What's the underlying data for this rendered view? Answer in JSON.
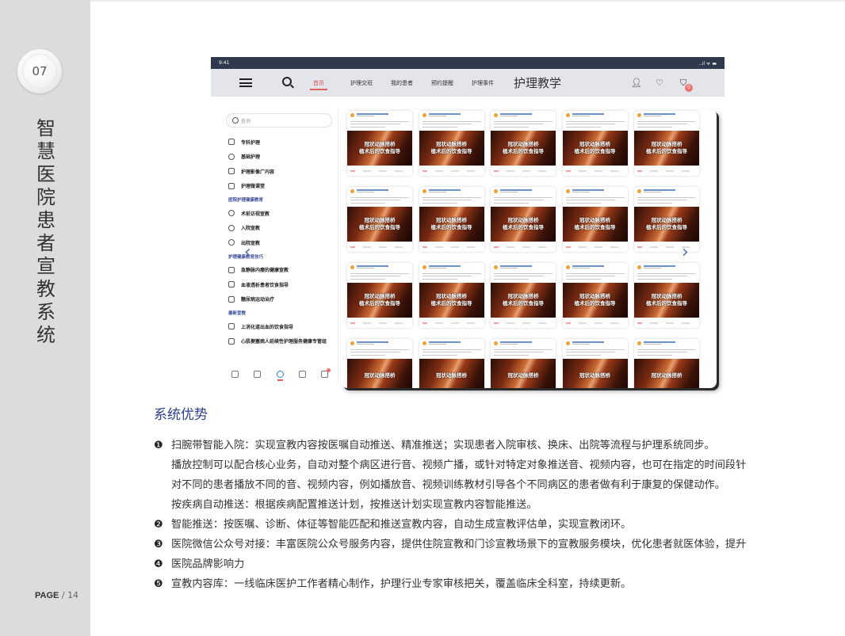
{
  "sidebar": {
    "section_number": "07",
    "vertical_title": [
      "智",
      "慧",
      "医",
      "院",
      "患",
      "者",
      "宣",
      "教",
      "系",
      "统"
    ],
    "page_label": "PAGE",
    "page_sep": " / ",
    "page_number": "14"
  },
  "app": {
    "status": {
      "time": "9:41",
      "right": "..ıl ᯤ ▬"
    },
    "nav": {
      "items": [
        "首页",
        "护理交班",
        "我的患者",
        "预约提醒",
        "护理事件"
      ],
      "title": "护理教学",
      "cart_count": "0"
    },
    "left_pane": {
      "search_placeholder": "查询",
      "items_top": [
        "专科护理",
        "基础护理",
        "护理影像广内容",
        "护理微课堂"
      ],
      "group1_head": "医院护理健康教育",
      "group1_items": [
        "术前访视宣教",
        "入院宣教",
        "出院宣教"
      ],
      "group2_head": "护理健康教育技巧",
      "group2_items": [
        "急静脉内瘘的健康宣教",
        "血液透析患者饮食指导",
        "糖尿病运动治疗"
      ],
      "group3_head": "最新宣教",
      "group3_items": [
        "上消化道出血的饮食指导",
        "心肌梗塞病人延续性护理服务健康专管组"
      ]
    },
    "card_label": "冠状动脉搭桥\n植术后的饮食指导",
    "card_label_short": "冠状动脉搭桥",
    "arrows": {
      "left": "‹",
      "right": "›"
    }
  },
  "content": {
    "section_title": "系统优势",
    "bullets": [
      {
        "marker": "❶",
        "text": "扫腕带智能入院：实现宣教内容按医嘱自动推送、精准推送；实现患者入院审核、换床、出院等流程与护理系统同步。"
      },
      {
        "marker": "",
        "text": "播放控制可以配合核心业务，自动对整个病区进行音、视频广播，或针对特定对象推送音、视频内容，也可在指定的时间段针"
      },
      {
        "marker": "",
        "text": "对不同的患者播放不同的音、视频内容，例如播放音、视频训练教材引导各个不同病区的患者做有利于康复的保健动作。"
      },
      {
        "marker": "",
        "text": "按疾病自动推送：根据疾病配置推送计划，按推送计划实现宣教内容智能推送。"
      },
      {
        "marker": "❷",
        "text": "智能推送：按医嘱、诊断、体征等智能匹配和推送宣教内容，自动生成宣教评估单，实现宣教闭环。"
      },
      {
        "marker": "❸",
        "text": "医院微信公众号对接：丰富医院公众号服务内容，提供住院宣教和门诊宣教场景下的宣教服务模块，优化患者就医体验，提升"
      },
      {
        "marker": "❹",
        "text": "医院品牌影响力"
      },
      {
        "marker": "❺",
        "text": "宣教内容库：一线临床医护工作者精心制作，护理行业专家审核把关，覆盖临床全科室，持续更新。"
      }
    ]
  }
}
